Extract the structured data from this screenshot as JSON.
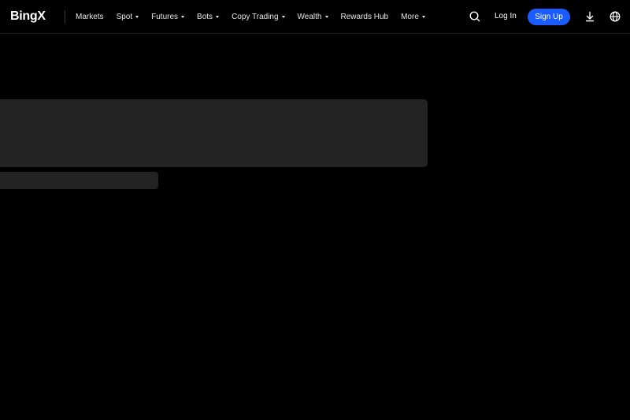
{
  "header": {
    "logo": "BingX",
    "nav": [
      {
        "label": "Markets",
        "dropdown": false
      },
      {
        "label": "Spot",
        "dropdown": true
      },
      {
        "label": "Futures",
        "dropdown": true
      },
      {
        "label": "Bots",
        "dropdown": true
      },
      {
        "label": "Copy Trading",
        "dropdown": true
      },
      {
        "label": "Wealth",
        "dropdown": true
      },
      {
        "label": "Rewards Hub",
        "dropdown": false
      },
      {
        "label": "More",
        "dropdown": true
      }
    ],
    "login_label": "Log In",
    "signup_label": "Sign Up",
    "icons": [
      "search-icon",
      "download-icon",
      "globe-icon"
    ]
  },
  "colors": {
    "background": "#000000",
    "accent": "#1a5cff",
    "skeleton": "#232323"
  }
}
